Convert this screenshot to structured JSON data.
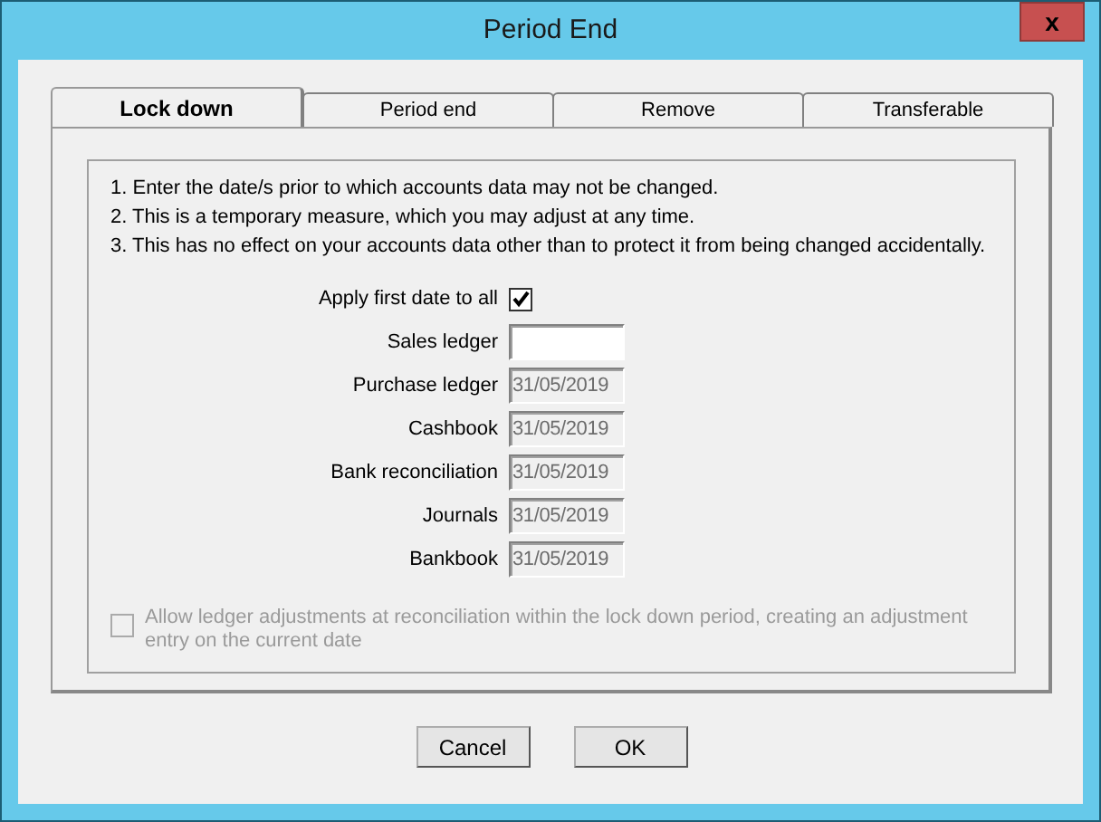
{
  "window": {
    "title": "Period End",
    "close": "x"
  },
  "tabs": [
    {
      "label": "Lock down",
      "selected": true
    },
    {
      "label": "Period end",
      "selected": false
    },
    {
      "label": "Remove",
      "selected": false
    },
    {
      "label": "Transferable",
      "selected": false
    }
  ],
  "instructions": [
    "1. Enter the date/s prior to which accounts data may not be changed.",
    "2. This is a temporary measure, which you may adjust at any time.",
    "3. This has no effect on your accounts data other than to protect it from being changed accidentally."
  ],
  "apply_first_date": {
    "label": "Apply first date to all",
    "checked": true
  },
  "fields": [
    {
      "label": "Sales ledger",
      "disabled": false
    },
    {
      "label": "Purchase ledger",
      "value": "31/05/2019",
      "disabled": true
    },
    {
      "label": "Cashbook",
      "value": "31/05/2019",
      "disabled": true
    },
    {
      "label": "Bank reconciliation",
      "value": "31/05/2019",
      "disabled": true
    },
    {
      "label": "Journals",
      "value": "31/05/2019",
      "disabled": true
    },
    {
      "label": "Bankbook",
      "value": "31/05/2019",
      "disabled": true
    }
  ],
  "allow_adjustments": {
    "label": "Allow ledger adjustments at reconciliation within the lock down period, creating an adjustment entry on the current date",
    "checked": false,
    "disabled": true
  },
  "buttons": [
    "Cancel",
    "OK"
  ]
}
